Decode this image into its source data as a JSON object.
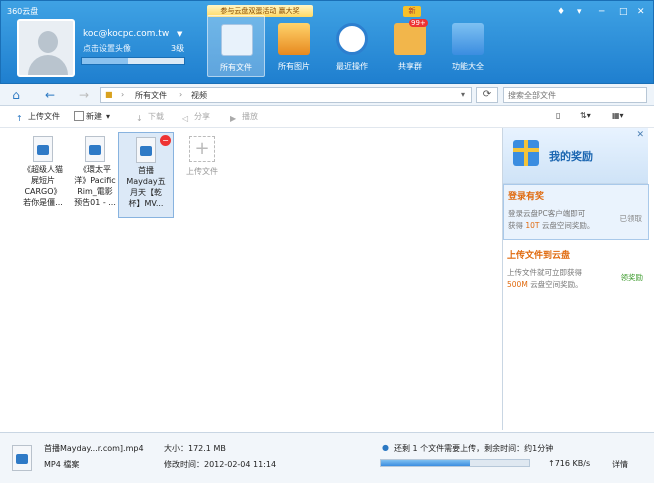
{
  "app": {
    "title": "360云盘",
    "promo": "参与云盘双蛋活动 赢大奖",
    "new_tag": "新"
  },
  "user": {
    "email": "koc@kocpc.com.tw",
    "set_avatar": "点击设置头像",
    "level": "3级",
    "capacity_used": 0.45
  },
  "nav_tabs": [
    {
      "label": "所有文件",
      "icon": "cloud-icon"
    },
    {
      "label": "所有图片",
      "icon": "picture-icon"
    },
    {
      "label": "最近操作",
      "icon": "clock-icon"
    },
    {
      "label": "共享群",
      "icon": "group-icon",
      "badge": "99+"
    },
    {
      "label": "功能大全",
      "icon": "toolbox-icon"
    }
  ],
  "path": {
    "root": "所有文件",
    "current": "视频"
  },
  "search": {
    "placeholder": "搜索全部文件"
  },
  "actions": [
    {
      "label": "上传文件",
      "icon": "upload-icon"
    },
    {
      "label": "新建",
      "icon": "new-icon"
    },
    {
      "label": "下载",
      "icon": "download-icon"
    },
    {
      "label": "分享",
      "icon": "share-icon"
    },
    {
      "label": "播放",
      "icon": "play-icon"
    }
  ],
  "files": [
    {
      "line1": "《超级人猫",
      "line2": "屍短片",
      "line3": "CARGO》",
      "line4": "若你是僵..."
    },
    {
      "line1": "《環太平",
      "line2": "洋》Pacific",
      "line3": "Rim_電影",
      "line4": "预告01 - ..."
    },
    {
      "line1": "首播",
      "line2": "Mayday五",
      "line3": "月天【乾",
      "line4": "杯】MV..."
    }
  ],
  "upload_slot": "上传文件",
  "panel": {
    "title": "我的奖励",
    "rewards": [
      {
        "title": "登录有奖",
        "desc_a": "登录云盘PC客户端即可",
        "desc_b": "获得",
        "amount": "10T",
        "desc_c": "云盘空间奖励。",
        "status": "已领取",
        "status_color": "#888888"
      },
      {
        "title": "上传文件到云盘",
        "desc_a": "上传文件就可立即获得",
        "desc_b": "",
        "amount": "500M",
        "desc_c": "云盘空间奖励。",
        "status": "领奖励",
        "status_color": "#3a9a2a"
      }
    ]
  },
  "status": {
    "name": "首播Mayday...r.com].mp4",
    "type": "MP4 檔案",
    "size": "大小：172.1 MB",
    "mtime": "修改时间：2012-02-04 11:14",
    "remaining": "还剩 1 个文件需要上传，剩余时间：约1分钟",
    "speed": "↑716 KB/s",
    "detail": "详情",
    "upload_progress": 0.6
  },
  "colors": {
    "accent": "#2b7fd0",
    "orange": "#e06a0e"
  }
}
